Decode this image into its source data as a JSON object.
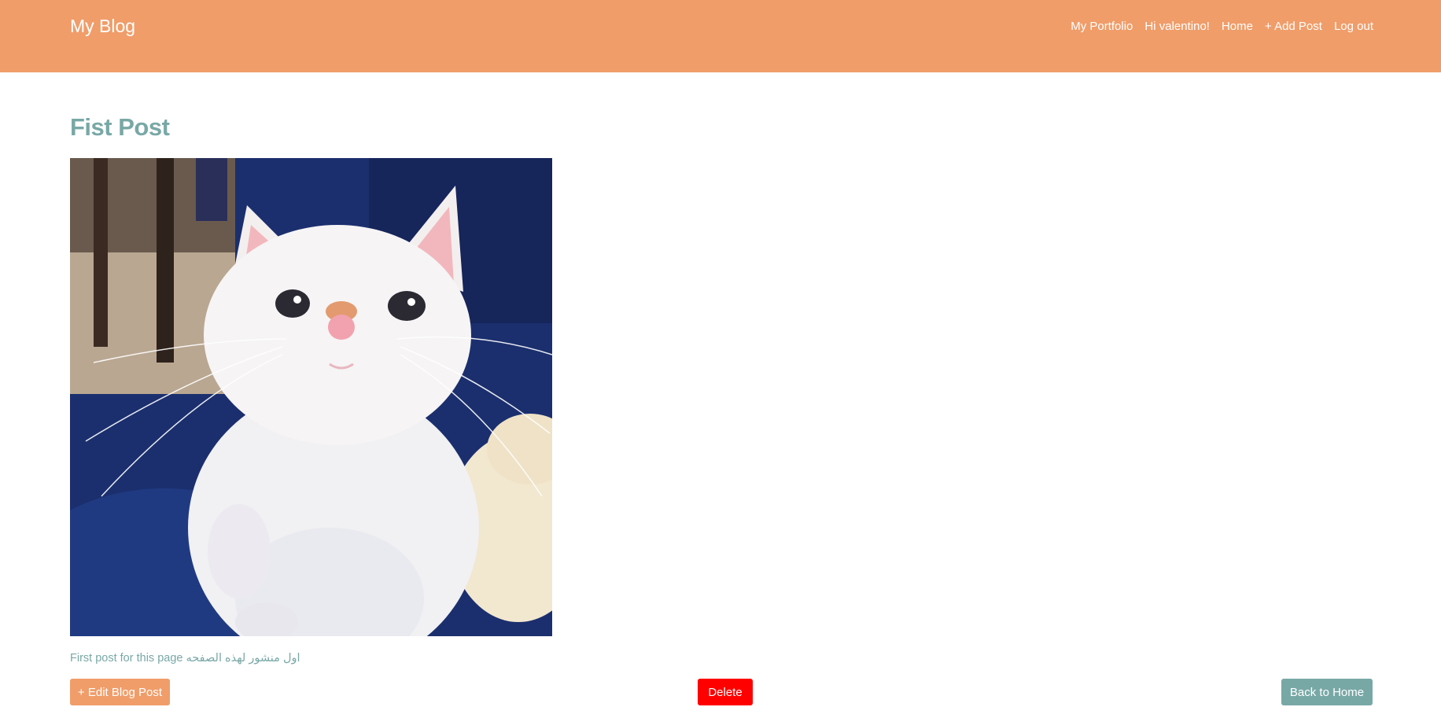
{
  "navbar": {
    "brand": "My Blog",
    "links": [
      {
        "label": "My Portfolio"
      },
      {
        "label": "Hi valentino!"
      },
      {
        "label": "Home"
      },
      {
        "label": "+ Add Post"
      },
      {
        "label": "Log out"
      }
    ],
    "background_color": "#f09d6a"
  },
  "post": {
    "title": "Fist Post",
    "image_subject": "white kitten",
    "body": "First post for this page اول منشور لهذه الصفحه"
  },
  "actions": {
    "edit_label": "+ Edit Blog Post",
    "delete_label": "Delete",
    "back_label": "Back to Home"
  },
  "colors": {
    "accent_orange": "#f09d6a",
    "accent_teal": "#78a8a6",
    "danger_red": "#ff0000"
  }
}
